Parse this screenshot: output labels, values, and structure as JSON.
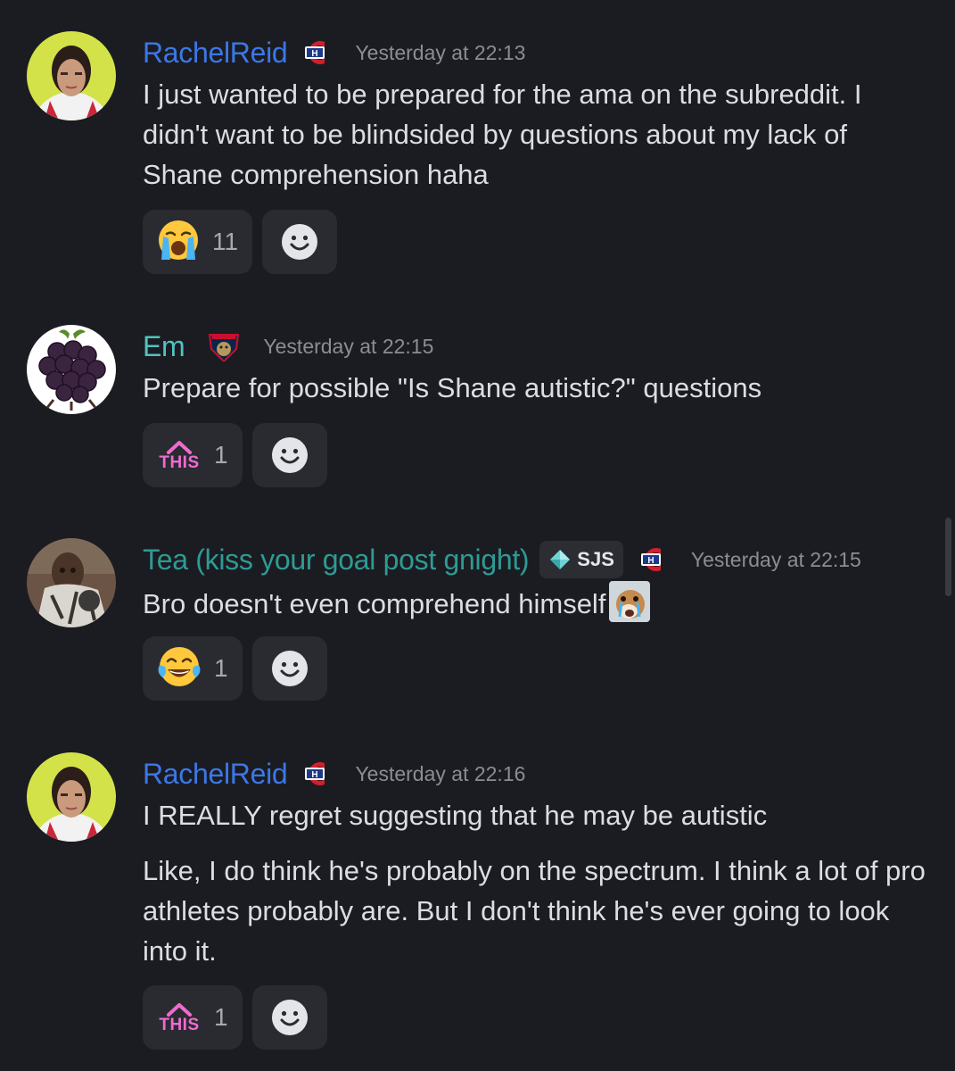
{
  "messages": [
    {
      "username": "RachelReid",
      "timestamp": "Yesterday at 22:13",
      "paragraphs": [
        "I just wanted to be prepared for the ama on the subreddit. I didn't want to be blindsided by questions about my lack of Shane comprehension haha"
      ],
      "reaction": {
        "icon": "loudly-crying-face-emoji",
        "count": "11"
      }
    },
    {
      "username": "Em",
      "timestamp": "Yesterday at 22:15",
      "paragraphs": [
        "Prepare for possible \"Is Shane autistic?\" questions"
      ],
      "reaction": {
        "icon": "this-emoji",
        "label": "THIS",
        "count": "1"
      }
    },
    {
      "username": "Tea (kiss your goal post gnight)",
      "tag": "SJS",
      "timestamp": "Yesterday at 22:15",
      "paragraphs": [
        "Bro doesn't even comprehend himself"
      ],
      "reaction": {
        "icon": "face-with-tears-of-joy-emoji",
        "count": "1"
      }
    },
    {
      "username": "RachelReid",
      "timestamp": "Yesterday at 22:16",
      "paragraphs": [
        "I REALLY regret suggesting that he may be autistic",
        "Like, I do think he's probably on the spectrum. I think a lot of pro athletes probably are. But I don't think he's ever going to look into it."
      ],
      "reaction": {
        "icon": "this-emoji",
        "label": "THIS",
        "count": "1"
      }
    }
  ],
  "colors": {
    "background": "#1b1c21",
    "username_rachel": "#3b78e8",
    "username_em": "#4fc3bf",
    "username_tea": "#2e9b94",
    "this_pink": "#f06bd0"
  }
}
